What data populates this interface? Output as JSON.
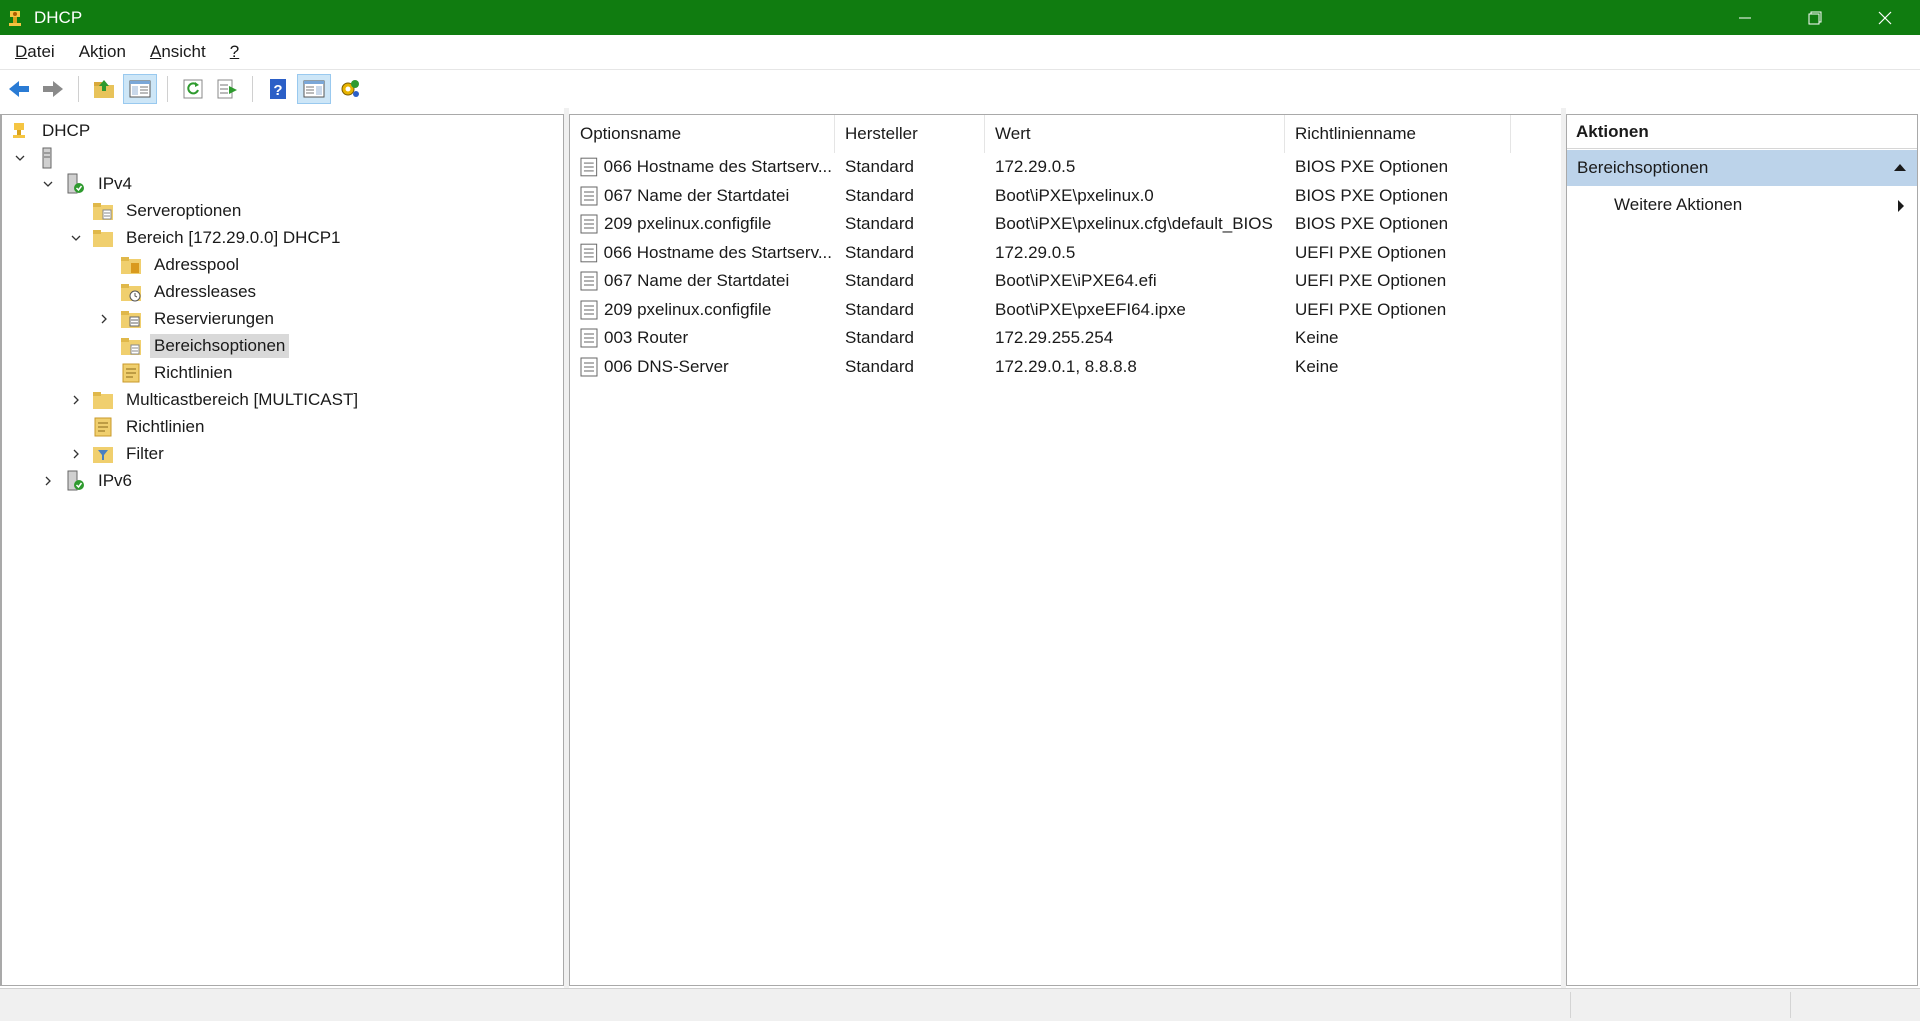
{
  "window": {
    "title": "DHCP",
    "accent": "#107c10"
  },
  "menu": [
    {
      "pre": "",
      "acc": "D",
      "post": "atei"
    },
    {
      "pre": "Ak",
      "acc": "t",
      "post": "ion"
    },
    {
      "pre": "",
      "acc": "A",
      "post": "nsicht"
    },
    {
      "pre": "",
      "acc": "?",
      "post": ""
    }
  ],
  "toolbar": {
    "icons": [
      "back-icon",
      "forward-icon",
      "up-folder-icon",
      "show-hide-tree-icon",
      "refresh-icon",
      "export-list-icon",
      "help-icon",
      "show-hide-action-pane-icon",
      "authorize-server-icon"
    ]
  },
  "tree": {
    "root": "DHCP",
    "server": "",
    "ipv4": "IPv4",
    "serveroptionen": "Serveroptionen",
    "bereich": "Bereich [172.29.0.0] DHCP1",
    "adresspool": "Adresspool",
    "adressleases": "Adressleases",
    "reservierungen": "Reservierungen",
    "bereichsoptionen": "Bereichsoptionen",
    "richtlinien_scope": "Richtlinien",
    "multicast": "Multicastbereich [MULTICAST]",
    "richtlinien": "Richtlinien",
    "filter": "Filter",
    "ipv6": "IPv6"
  },
  "list": {
    "columns": [
      "Optionsname",
      "Hersteller",
      "Wert",
      "Richtlinienname"
    ],
    "rows": [
      [
        "066 Hostname des Startserv...",
        "Standard",
        "172.29.0.5",
        "BIOS PXE Optionen"
      ],
      [
        "067 Name der Startdatei",
        "Standard",
        "Boot\\iPXE\\pxelinux.0",
        "BIOS PXE Optionen"
      ],
      [
        "209 pxelinux.configfile",
        "Standard",
        "Boot\\iPXE\\pxelinux.cfg\\default_BIOS",
        "BIOS PXE Optionen"
      ],
      [
        "066 Hostname des Startserv...",
        "Standard",
        "172.29.0.5",
        "UEFI PXE Optionen"
      ],
      [
        "067 Name der Startdatei",
        "Standard",
        "Boot\\iPXE\\iPXE64.efi",
        "UEFI PXE Optionen"
      ],
      [
        "209 pxelinux.configfile",
        "Standard",
        "Boot\\iPXE\\pxeEFI64.ipxe",
        "UEFI PXE Optionen"
      ],
      [
        "003 Router",
        "Standard",
        "172.29.255.254",
        "Keine"
      ],
      [
        "006 DNS-Server",
        "Standard",
        "172.29.0.1, 8.8.8.8",
        "Keine"
      ]
    ]
  },
  "actions": {
    "header": "Aktionen",
    "section": "Bereichsoptionen",
    "item": "Weitere Aktionen",
    "section_color": "#bcd3ea"
  }
}
